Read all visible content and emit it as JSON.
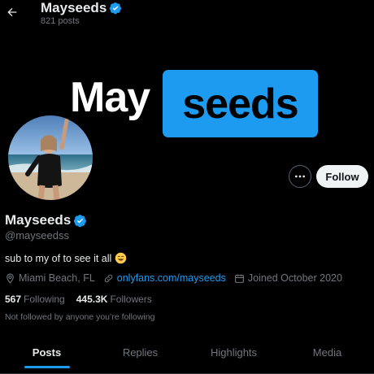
{
  "header": {
    "name": "Mayseeds",
    "posts": "821 posts"
  },
  "banner": {
    "word1": "May",
    "word2": "seeds"
  },
  "profile": {
    "display_name": "Mayseeds",
    "handle": "@mayseedss",
    "bio": "sub to my of to see it all",
    "location": "Miami Beach, FL",
    "link": "onlyfans.com/mayseeds",
    "joined": "Joined October 2020",
    "following_count": "567",
    "following_label": "Following",
    "followers_count": "445.3K",
    "followers_label": "Followers",
    "not_followed": "Not followed by anyone you’re following"
  },
  "actions": {
    "follow_label": "Follow",
    "more_icon": "more-icon"
  },
  "tabs": [
    {
      "label": "Posts",
      "active": true
    },
    {
      "label": "Replies",
      "active": false
    },
    {
      "label": "Highlights",
      "active": false
    },
    {
      "label": "Media",
      "active": false
    }
  ],
  "colors": {
    "accent": "#1d9bf0",
    "background": "#000000",
    "text": "#e7e9ea",
    "secondary": "#71767b"
  }
}
